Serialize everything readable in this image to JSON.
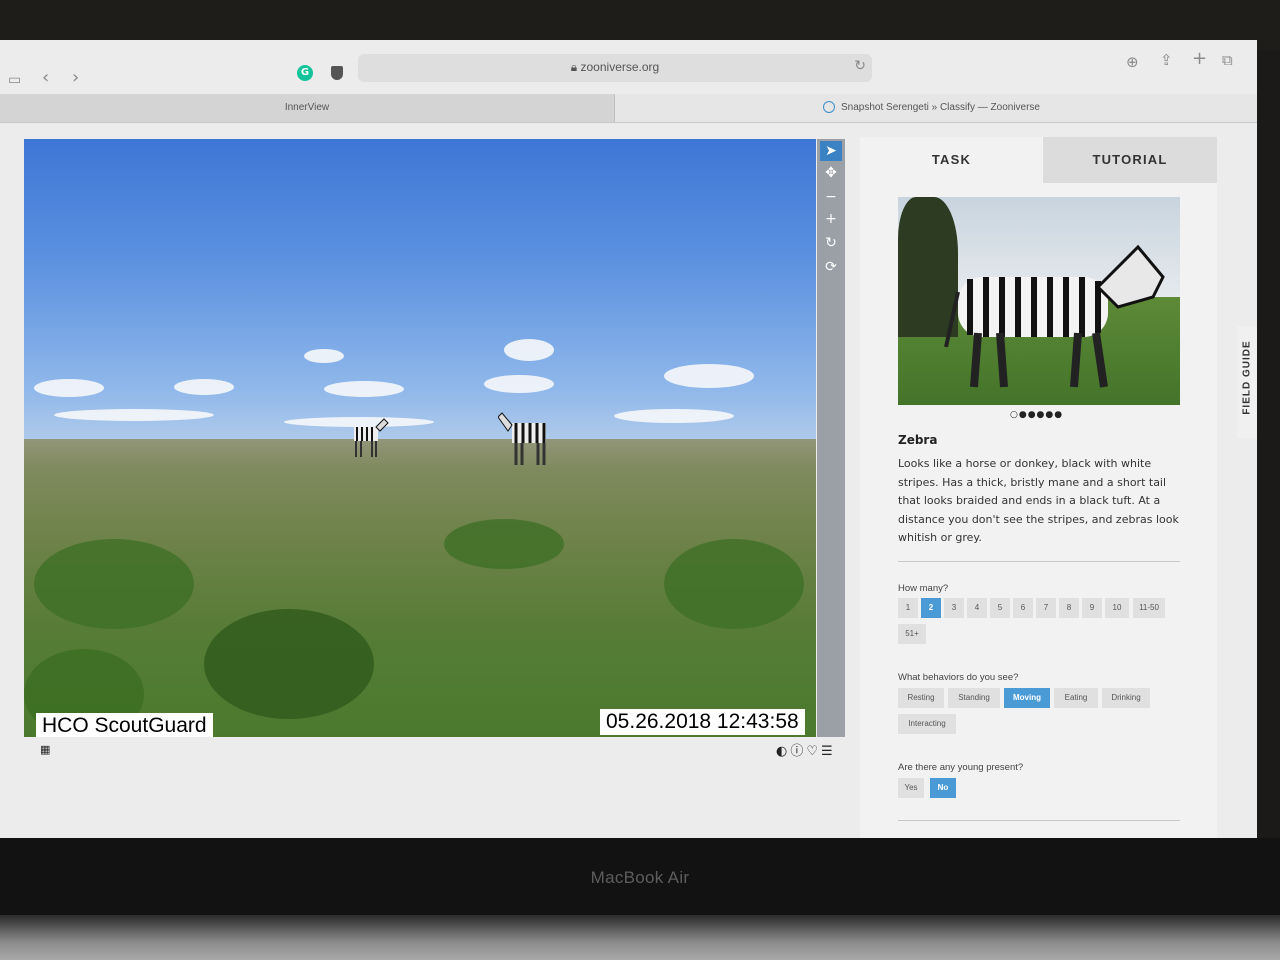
{
  "browser": {
    "url": "zooniverse.org",
    "tabs": [
      {
        "label": "InnerView"
      },
      {
        "label": "Snapshot Serengeti » Classify — Zooniverse"
      }
    ]
  },
  "viewer": {
    "camera_label": "HCO ScoutGuard",
    "timestamp": "05.26.2018 12:43:58",
    "tools": [
      "pointer-icon",
      "move-icon",
      "zoom-out-icon",
      "zoom-in-icon",
      "rotate-icon",
      "reset-icon"
    ]
  },
  "panel": {
    "tabs": {
      "task": "TASK",
      "tutorial": "TUTORIAL"
    },
    "field_guide": "FIELD GUIDE",
    "animal": {
      "name": "Zebra",
      "description": "Looks like a horse or donkey, black with white stripes. Has a thick, bristly mane and a short tail that looks braided and ends in a black tuft. At a distance you don't see the stripes, and zebras look whitish or grey."
    },
    "how_many": {
      "question": "How many?",
      "options": [
        "1",
        "2",
        "3",
        "4",
        "5",
        "6",
        "7",
        "8",
        "9",
        "10",
        "11-50",
        "51+"
      ],
      "selected": "2"
    },
    "behaviors": {
      "question": "What behaviors do you see?",
      "options": [
        "Resting",
        "Standing",
        "Moving",
        "Eating",
        "Drinking",
        "Interacting"
      ],
      "selected": "Moving"
    },
    "young": {
      "question": "Are there any young present?",
      "options": [
        "Yes",
        "No"
      ],
      "selected": "No"
    }
  },
  "device": {
    "brand": "MacBook Air"
  },
  "colors": {
    "accent": "#4a9ad6",
    "tool_bg": "#9aa0a6"
  }
}
